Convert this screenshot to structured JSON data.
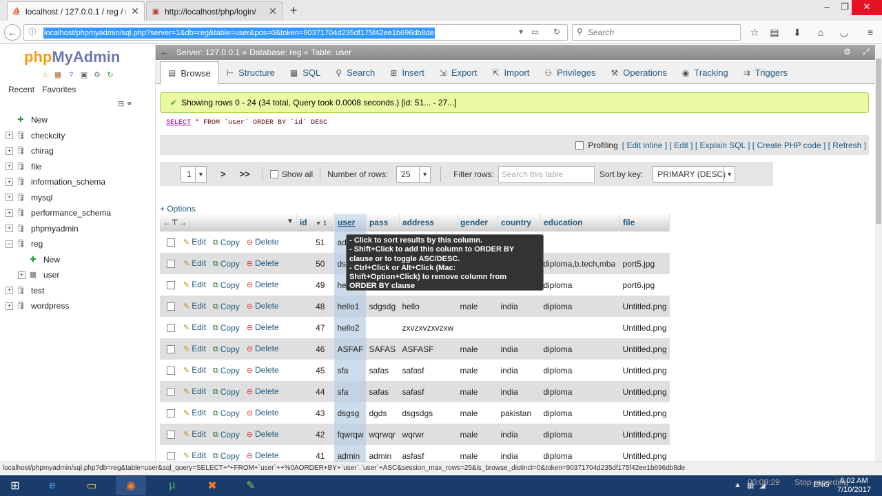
{
  "browser": {
    "tabs": [
      {
        "title": "localhost / 127.0.0.1 / reg / u",
        "active": true
      },
      {
        "title": "http://localhost/php/login/",
        "active": false
      }
    ],
    "url": "localhost/phpmyadmin/sql.php?server=1&db=reg&table=user&pos=0&token=90371704d235df175f42ee1b696db8de",
    "search_placeholder": "Search",
    "status_url": "localhost/phpmyadmin/sql.php?db=reg&table=user&sql_query=SELECT+*+FROM+`user`++%0AORDER+BY+`user`.`user`+ASC&session_max_rows=25&is_browse_distinct=0&token=90371704d235df175f42ee1b696db8de"
  },
  "sidebar": {
    "logo_php": "php",
    "logo_myadmin": "MyAdmin",
    "links": [
      "Recent",
      "Favorites"
    ],
    "tree": [
      {
        "label": "New",
        "icon": "new-icon",
        "indent": 0
      },
      {
        "label": "checkcity",
        "icon": "database-icon",
        "indent": 0
      },
      {
        "label": "chirag",
        "icon": "database-icon",
        "indent": 0
      },
      {
        "label": "file",
        "icon": "database-icon",
        "indent": 0
      },
      {
        "label": "information_schema",
        "icon": "database-icon",
        "indent": 0
      },
      {
        "label": "mysql",
        "icon": "database-icon",
        "indent": 0
      },
      {
        "label": "performance_schema",
        "icon": "database-icon",
        "indent": 0
      },
      {
        "label": "phpmyadmin",
        "icon": "database-icon",
        "indent": 0
      },
      {
        "label": "reg",
        "icon": "database-icon",
        "indent": 0
      },
      {
        "label": "New",
        "icon": "new-icon",
        "indent": 1
      },
      {
        "label": "user",
        "icon": "table-icon",
        "indent": 1
      },
      {
        "label": "test",
        "icon": "database-icon",
        "indent": 0
      },
      {
        "label": "wordpress",
        "icon": "database-icon",
        "indent": 0
      }
    ]
  },
  "breadcrumb": {
    "server": "Server: 127.0.0.1 »",
    "database": "Database: reg »",
    "table": "Table: user"
  },
  "main_tabs": [
    "Browse",
    "Structure",
    "SQL",
    "Search",
    "Insert",
    "Export",
    "Import",
    "Privileges",
    "Operations",
    "Tracking",
    "Triggers"
  ],
  "message": "Showing rows 0 - 24 (34 total, Query took 0.0008 seconds.) [id: 51... - 27...]",
  "sql": {
    "kw": "SELECT",
    "rest": " * FROM `user` ORDER BY `id` DESC"
  },
  "profiling": {
    "label": "Profiling",
    "links": [
      "[ Edit inline ]",
      "[ Edit ]",
      "[ Explain SQL ]",
      "[ Create PHP code ]",
      "[ Refresh ]"
    ]
  },
  "nav": {
    "page": "1",
    "next": ">",
    "last": ">>",
    "show_all": "Show all",
    "rows_label": "Number of rows:",
    "rows_value": "25",
    "filter_label": "Filter rows:",
    "filter_placeholder": "Search this table",
    "sort_label": "Sort by key:",
    "sort_value": "PRIMARY (DESC)"
  },
  "options_link": "+ Options",
  "columns": [
    "id",
    "user",
    "pass",
    "address",
    "gender",
    "country",
    "education",
    "file"
  ],
  "sort_indicator": "1",
  "actions": {
    "edit": "Edit",
    "copy": "Copy",
    "delete": "Delete"
  },
  "rows": [
    {
      "id": "51",
      "user": "adm",
      "pass": "",
      "address": "",
      "gender": "",
      "country": "",
      "education": "",
      "file": ""
    },
    {
      "id": "50",
      "user": "ds",
      "pass": "",
      "address": "",
      "gender": "male",
      "country": "pakistan",
      "education": "diploma,b.tech,mba",
      "file": "port5.jpg"
    },
    {
      "id": "49",
      "user": "he",
      "pass": "",
      "address": "ahmedabad",
      "gender": "male",
      "country": "india",
      "education": "diploma",
      "file": "port6.jpg"
    },
    {
      "id": "48",
      "user": "hello1",
      "pass": "sdgsdg",
      "address": "hello",
      "gender": "male",
      "country": "india",
      "education": "diploma",
      "file": "Untitled.png"
    },
    {
      "id": "47",
      "user": "hello2",
      "pass": "",
      "address": "zxvzxvzxvzxw",
      "gender": "",
      "country": "",
      "education": "",
      "file": "Untitled.png"
    },
    {
      "id": "46",
      "user": "ASFAF",
      "pass": "SAFAS",
      "address": "ASFASF",
      "gender": "male",
      "country": "india",
      "education": "diploma",
      "file": "Untitled.png"
    },
    {
      "id": "45",
      "user": "sfa",
      "pass": "safas",
      "address": "safasf",
      "gender": "male",
      "country": "india",
      "education": "diploma",
      "file": "Untitled.png"
    },
    {
      "id": "44",
      "user": "sfa",
      "pass": "safas",
      "address": "safasf",
      "gender": "male",
      "country": "india",
      "education": "diploma",
      "file": "Untitled.png"
    },
    {
      "id": "43",
      "user": "dsgsg",
      "pass": "dgds",
      "address": "dsgsdgs",
      "gender": "male",
      "country": "pakistan",
      "education": "diploma",
      "file": "Untitled.png"
    },
    {
      "id": "42",
      "user": "fqwrqw",
      "pass": "wqrwqr",
      "address": "wqrwr",
      "gender": "male",
      "country": "india",
      "education": "diploma",
      "file": "Untitled.png"
    },
    {
      "id": "41",
      "user": "admin",
      "pass": "admin",
      "address": "asfasf",
      "gender": "male",
      "country": "india",
      "education": "diploma",
      "file": "Untitled.png"
    }
  ],
  "tooltip": [
    "- Click to sort results by this column.",
    "- Shift+Click to add this column to ORDER BY",
    "clause or to toggle ASC/DESC.",
    "- Ctrl+Click or Alt+Click (Mac:",
    "Shift+Option+Click) to remove column from",
    "ORDER BY clause"
  ],
  "taskbar": {
    "recording_time": "00:08:29",
    "recording_label": "Stop recording",
    "lang": "ENG",
    "time": "6:02 AM",
    "date": "7/10/2017"
  }
}
